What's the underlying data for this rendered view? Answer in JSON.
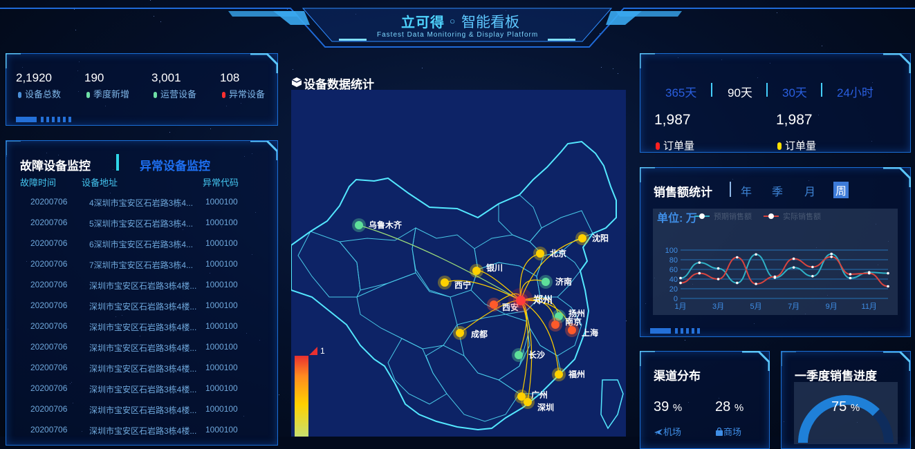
{
  "header": {
    "logo_text": "立可得",
    "title": "◦ 智能看板",
    "subtitle": "Fastest Data Monitoring & Display Platform"
  },
  "stats": [
    {
      "value": "2,1920",
      "label": "设备总数",
      "color": "#4a8fd8"
    },
    {
      "value": "190",
      "label": "季度新增",
      "color": "#6fe0a6"
    },
    {
      "value": "3,001",
      "label": "运营设备",
      "color": "#6fe0a6"
    },
    {
      "value": "108",
      "label": "异常设备",
      "color": "#ff3030"
    }
  ],
  "fault_monitor": {
    "tab_active": "故障设备监控",
    "tab_inactive": "异常设备监控",
    "columns": [
      "故障时间",
      "设备地址",
      "异常代码"
    ],
    "rows": [
      [
        "20200706",
        "4深圳市宝安区石岩路3栋4...",
        "1000100"
      ],
      [
        "20200706",
        "5深圳市宝安区石岩路3栋4...",
        "1000100"
      ],
      [
        "20200706",
        "6深圳市宝安区石岩路3栋4...",
        "1000100"
      ],
      [
        "20200706",
        "7深圳市宝安区石岩路3栋4...",
        "1000100"
      ],
      [
        "20200706",
        "深圳市宝安区石岩路3栋4楼...",
        "1000100"
      ],
      [
        "20200706",
        "深圳市宝安区石岩路3栋4楼...",
        "1000100"
      ],
      [
        "20200706",
        "深圳市宝安区石岩路3栋4楼...",
        "1000100"
      ],
      [
        "20200706",
        "深圳市宝安区石岩路3栋4楼...",
        "1000100"
      ],
      [
        "20200706",
        "深圳市宝安区石岩路3栋4楼...",
        "1000100"
      ],
      [
        "20200706",
        "深圳市宝安区石岩路3栋4楼...",
        "1000100"
      ],
      [
        "20200706",
        "深圳市宝安区石岩路3栋4楼...",
        "1000100"
      ],
      [
        "20200706",
        "深圳市宝安区石岩路3栋4楼...",
        "1000100"
      ]
    ]
  },
  "map": {
    "title": "设备数据统计",
    "legend_max": "1",
    "hub": "郑州",
    "cities": [
      "乌鲁木齐",
      "银川",
      "西宁",
      "西安",
      "北京",
      "沈阳",
      "济南",
      "扬州",
      "南京",
      "上海",
      "成都",
      "长沙",
      "福州",
      "广州",
      "深圳"
    ]
  },
  "orders": {
    "periods": [
      "365天",
      "90天",
      "30天",
      "24小时"
    ],
    "active_period": "90天",
    "items": [
      {
        "value": "1,987",
        "label": "订单量",
        "color": "#ff2020"
      },
      {
        "value": "1,987",
        "label": "订单量",
        "color": "#ffe000"
      }
    ]
  },
  "sales": {
    "title": "销售额统计",
    "tabs": [
      "年",
      "季",
      "月",
      "周"
    ],
    "active_tab": "周",
    "unit_label": "单位: 万",
    "legend": [
      "预期销售额",
      "实际销售额"
    ]
  },
  "chart_data": {
    "type": "line",
    "x": [
      "1月",
      "2月",
      "3月",
      "4月",
      "5月",
      "6月",
      "7月",
      "8月",
      "9月",
      "10月",
      "11月",
      "12月"
    ],
    "xticks": [
      "1月",
      "3月",
      "5月",
      "7月",
      "9月",
      "11月"
    ],
    "ylim": [
      0,
      100
    ],
    "yticks": [
      0,
      20,
      40,
      60,
      80,
      100
    ],
    "grid": true,
    "series": [
      {
        "name": "预期销售额",
        "color": "#2fb1c6",
        "values": [
          42,
          74,
          62,
          32,
          91,
          43,
          64,
          46,
          92,
          42,
          54,
          52
        ]
      },
      {
        "name": "实际销售额",
        "color": "#d9443e",
        "values": [
          32,
          52,
          40,
          85,
          30,
          45,
          82,
          65,
          86,
          50,
          52,
          25
        ]
      }
    ]
  },
  "channels": {
    "title": "渠道分布",
    "items": [
      {
        "percent": "39",
        "unit": "%",
        "label": "机场"
      },
      {
        "percent": "28",
        "unit": "%",
        "label": "商场"
      }
    ]
  },
  "quarter_progress": {
    "title": "一季度销售进度",
    "percent": "75",
    "unit": "%",
    "value": 0.75
  }
}
